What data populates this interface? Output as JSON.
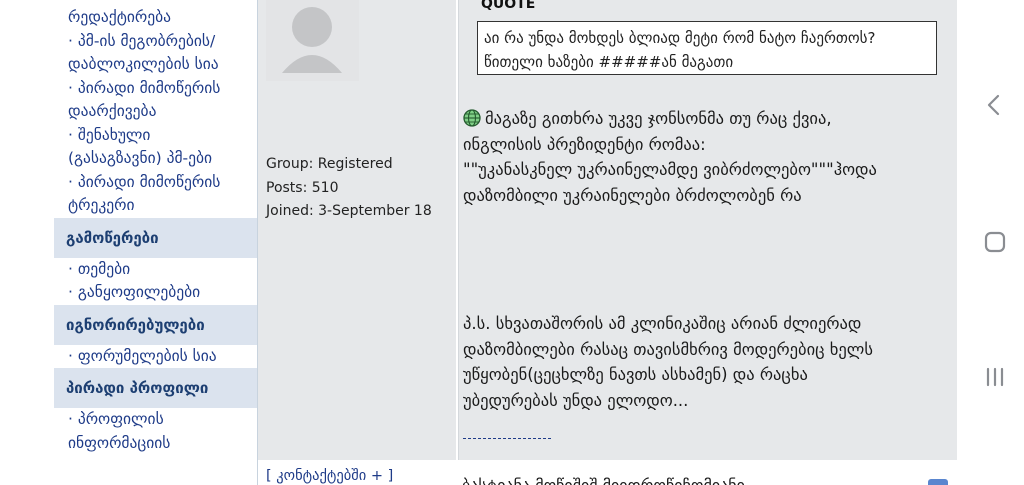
{
  "sidebar": {
    "items": [
      {
        "type": "item",
        "label": "რედაქტირება"
      },
      {
        "type": "item",
        "label": "· პმ-ის მეგობრების/"
      },
      {
        "type": "item",
        "label": "დაბლოკილების სია"
      },
      {
        "type": "item",
        "label": "· პირადი მიმოწერის"
      },
      {
        "type": "item",
        "label": "დაარქივება"
      },
      {
        "type": "item",
        "label": "· შენახული"
      },
      {
        "type": "item",
        "label": "(გასაგზავნი) პმ-ები"
      },
      {
        "type": "item",
        "label": "· პირადი მიმოწერის"
      },
      {
        "type": "item",
        "label": "ტრეკერი"
      },
      {
        "type": "head",
        "label": "გამოწერები"
      },
      {
        "type": "item",
        "label": "· თემები"
      },
      {
        "type": "item",
        "label": "· განყოფილებები"
      },
      {
        "type": "head",
        "label": "იგნორირებულები"
      },
      {
        "type": "item",
        "label": "· ფორუმელების სია"
      },
      {
        "type": "head",
        "label": "პირადი პროფილი"
      },
      {
        "type": "item",
        "label": "· პროფილის"
      },
      {
        "type": "item",
        "label": "ინფორმაციის"
      }
    ]
  },
  "profile": {
    "group": "Group: Registered",
    "posts": "Posts: 510",
    "joined": "Joined: 3-September 18",
    "contact_link": "[ კონტაქტებში + ]"
  },
  "post": {
    "quote_label": "QUOTE",
    "quote_line1": "აი რა უნდა მოხდეს ბლიად მეტი რომ ნატო ჩაერთოს?",
    "quote_line2": "წითელი ხაზები #####ან მაგათი",
    "p1_line1": "მაგაზე გითხრა უკვე ჯონსონმა თუ რაც ქვია,",
    "p1_line2": "ინგლისის პრეზიდენტი რომაა:",
    "p1_line3": "\"\"უკანასკნელ უკრაინელამდე ვიბრძოლებო\"\"\"ჰოდა",
    "p1_line4": "დაზომბილი უკრაინელები ბრძოლობენ რა",
    "p2_line1": "პ.ს. სხვათაშორის ამ კლინიკაშიც არიან ძლიერად",
    "p2_line2": "დაზომბილები რასაც თავისმხრივ მოდერებიც ხელს",
    "p2_line3": "უწყობენ(ცეცხლზე ნავთს ასხამენ) და რაცხა",
    "p2_line4": "უბედურებას უნდა ელოდო...",
    "next_cut": "ბასტიანა მოწიშიშ მიიდროწიჩომიანი"
  },
  "icons": {
    "back": "chevron-left-icon",
    "home": "home-square-icon",
    "recents": "recents-bars-icon",
    "avatar": "default-avatar-icon",
    "globe": "globe-emoji-icon"
  },
  "colors": {
    "link": "#1e3b88",
    "section_head_bg": "#dbe3ee",
    "post_bg": "#e6e8ea"
  }
}
